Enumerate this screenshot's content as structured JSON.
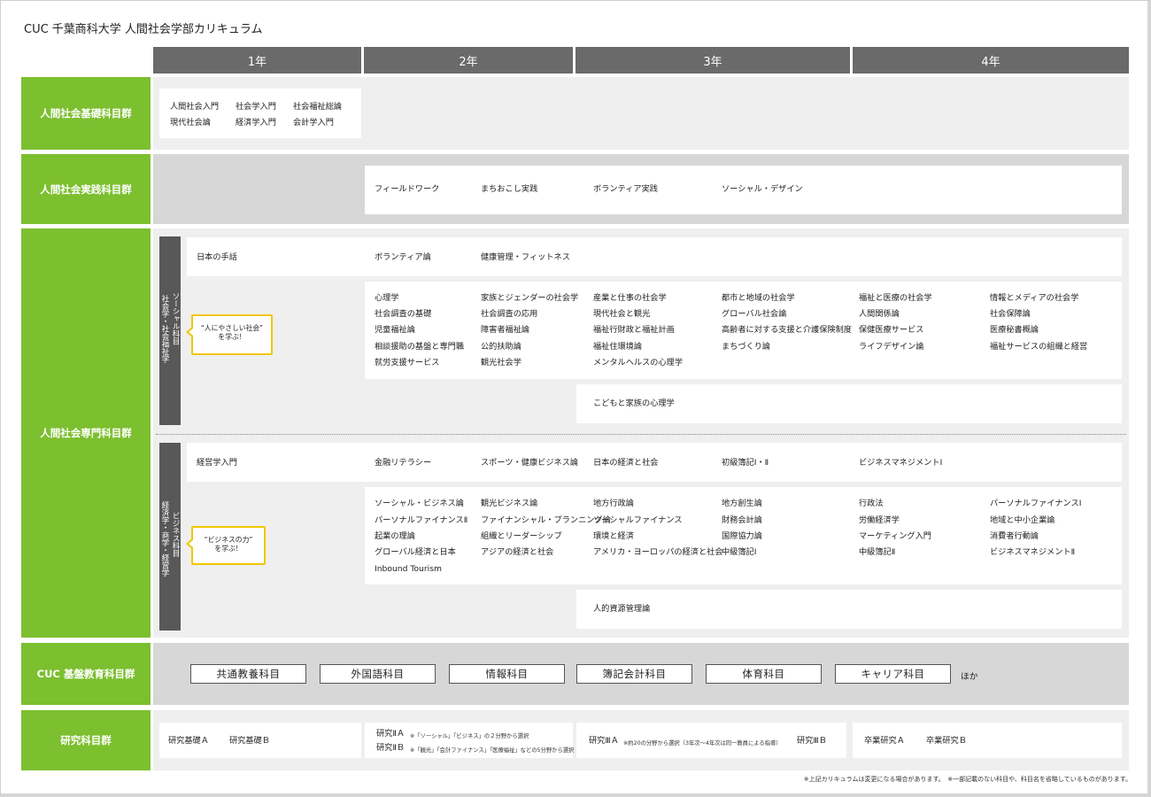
{
  "title": "CUC 千葉商科大学  人間社会学部カリキュラム",
  "years": [
    "1年",
    "2年",
    "3年",
    "4年"
  ],
  "groups": {
    "kiso": "人間社会基礎科目群",
    "jissen": "人間社会実践科目群",
    "senmon": "人間社会専門科目群",
    "kiban": "CUC 基盤教育科目群",
    "kenkyu": "研究科目群"
  },
  "kiso_courses": [
    "人間社会入門",
    "社会学入門",
    "社会福祉総論",
    "現代社会論",
    "経済学入門",
    "会計学入門"
  ],
  "jissen_courses": [
    "フィールドワーク",
    "まちおこし実践",
    "ボランティア実践",
    "ソーシャル・デザイン"
  ],
  "social": {
    "bar_title": "ソーシャル科目",
    "bar_sub": "社会学・社会福祉学",
    "callout_line1": "“人にやさしい社会”",
    "callout_line2": "を学ぶ！",
    "row1": [
      "日本の手話",
      "ボランティア論",
      "健康管理・フィットネス"
    ],
    "col_2a": [
      "心理学",
      "社会調査の基礎",
      "児童福祉論",
      "相談援助の基盤と専門職",
      "就労支援サービス"
    ],
    "col_2b": [
      "家族とジェンダーの社会学",
      "社会調査の応用",
      "障害者福祉論",
      "公的扶助論",
      "観光社会学"
    ],
    "col_3a": [
      "産業と仕事の社会学",
      "現代社会と観光",
      "福祉行財政と福祉計画",
      "福祉住環境論",
      "メンタルヘルスの心理学"
    ],
    "col_3b": [
      "都市と地域の社会学",
      "グローバル社会論",
      "高齢者に対する支援と介護保険制度",
      "まちづくり論"
    ],
    "col_4a": [
      "福祉と医療の社会学",
      "人間関係論",
      "保健医療サービス",
      "ライフデザイン論"
    ],
    "col_4b": [
      "情報とメディアの社会学",
      "社会保障論",
      "医療秘書概論",
      "福祉サービスの組織と経営"
    ],
    "row3": "こどもと家族の心理学"
  },
  "business": {
    "bar_title": "ビジネス科目",
    "bar_sub": "経済学・商学・経営学",
    "callout_line1": "“ビジネスの力”",
    "callout_line2": "を学ぶ！",
    "row1": [
      "経営学入門",
      "金融リテラシー",
      "スポーツ・健康ビジネス論",
      "日本の経済と社会",
      "初級簿記Ⅰ・Ⅱ",
      "ビジネスマネジメントⅠ"
    ],
    "col_2a": [
      "ソーシャル・ビジネス論",
      "パーソナルファイナンスⅡ",
      "起業の理論",
      "グローバル経済と日本",
      "Inbound Tourism"
    ],
    "col_2b": [
      "観光ビジネス論",
      "ファイナンシャル・プランニング論",
      "組織とリーダーシップ",
      "アジアの経済と社会"
    ],
    "col_3a": [
      "地方行政論",
      "ソーシャルファイナンス",
      "環境と経済",
      "アメリカ・ヨーロッパの経済と社会"
    ],
    "col_3b": [
      "地方創生論",
      "財務会計論",
      "国際協力論",
      "中級簿記Ⅰ"
    ],
    "col_4a": [
      "行政法",
      "労働経済学",
      "マーケティング入門",
      "中級簿記Ⅱ"
    ],
    "col_4b": [
      "パーソナルファイナンスⅠ",
      "地域と中小企業論",
      "消費者行動論",
      "ビジネスマネジメントⅡ"
    ],
    "row3": "人的資源管理論"
  },
  "kiban_courses": [
    "共通教養科目",
    "外国語科目",
    "情報科目",
    "簿記会計科目",
    "体育科目",
    "キャリア科目"
  ],
  "kiban_suffix": "ほか",
  "kenkyu": {
    "y1": [
      "研究基礎Ａ",
      "研究基礎Ｂ"
    ],
    "y2a": "研究ⅡＡ",
    "y2a_note": "※「ソーシャル」「ビジネス」の２分野から選択",
    "y2b": "研究ⅡＢ",
    "y2b_note": "※「観光」「会計ファイナンス」「医療福祉」などの5分野から選択",
    "y3a": "研究ⅢＡ",
    "y3a_note": "※約20の分野から選択（3年次〜4年次は同一教員による指導）",
    "y3b": "研究ⅢＢ",
    "y4": [
      "卒業研究Ａ",
      "卒業研究Ｂ"
    ]
  },
  "footnote": "※上記カリキュラムは変更になる場合があります。　※一部記載のない科目や、科目名を省略しているものがあります。",
  "colors": {
    "green": "#7cbf2f",
    "header_gray": "#6a6a6a",
    "callout_yellow": "#f0c800"
  }
}
